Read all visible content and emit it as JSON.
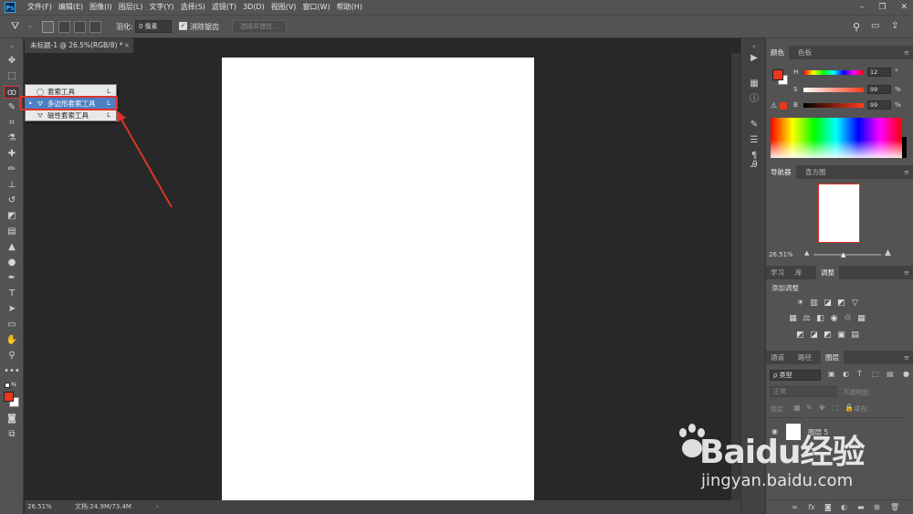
{
  "menubar": {
    "logo": "Ps",
    "items": [
      "文件(F)",
      "编辑(E)",
      "图像(I)",
      "图层(L)",
      "文字(Y)",
      "选择(S)",
      "滤镜(T)",
      "3D(D)",
      "视图(V)",
      "窗口(W)",
      "帮助(H)"
    ]
  },
  "options": {
    "feather_label": "羽化:",
    "feather_value": "0 像素",
    "antialias_label": "消除锯齿",
    "antialias_check": "✓",
    "select_mask_label": "选择并遮住..."
  },
  "document": {
    "tab_title": "未标题-1 @ 26.5%(RGB/8) *",
    "tab_close": "×",
    "zoom": "26.51%",
    "doc_info": "文档:24.9M/73.4M",
    "status_arrow": "›"
  },
  "flyout": {
    "items": [
      {
        "label": "套索工具",
        "shortcut": "L",
        "icon": "lasso-icon"
      },
      {
        "label": "多边形套索工具",
        "shortcut": "L",
        "icon": "polygonal-lasso-icon",
        "selected": true,
        "marker": "•"
      },
      {
        "label": "磁性套索工具",
        "shortcut": "L",
        "icon": "magnetic-lasso-icon"
      }
    ]
  },
  "color_panel": {
    "tabs": [
      "颜色",
      "色板"
    ],
    "h_label": "H",
    "h_value": "12",
    "h_unit": "°",
    "s_label": "S",
    "s_value": "99",
    "s_unit": "%",
    "b_label": "B",
    "b_value": "99",
    "b_unit": "%",
    "foreground": "#e8371d"
  },
  "navigator": {
    "tabs": [
      "导航器",
      "直方图"
    ],
    "zoom": "26.51%"
  },
  "adjustments": {
    "tabs": [
      "学习",
      "库",
      "调整"
    ],
    "title": "添加调整"
  },
  "layers": {
    "tabs": [
      "通道",
      "路径",
      "图层"
    ],
    "filter": "ρ 类型",
    "blend_mode": "正常",
    "opacity_label": "不透明度:",
    "lock_label": "锁定:",
    "fill_label": "填充:",
    "rows": [
      {
        "name": "图层 5"
      }
    ]
  },
  "watermark": {
    "brand": "Baidu经验",
    "url": "jingyan.baidu.com"
  },
  "colors": {
    "accent_red": "#e0312a",
    "menu_bg": "#535353",
    "canvas_bg": "#282828"
  }
}
